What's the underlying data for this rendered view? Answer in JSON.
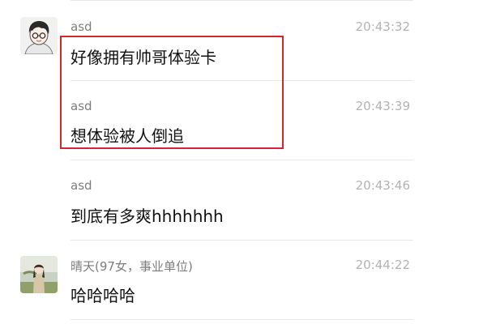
{
  "messages": [
    {
      "sender": "asd",
      "time": "20:43:32",
      "text": "好像拥有帅哥体验卡",
      "avatar": "boy-glasses-cartoon"
    },
    {
      "sender": "asd",
      "time": "20:43:39",
      "text": "想体验被人倒追"
    },
    {
      "sender": "asd",
      "time": "20:43:46",
      "text": "到底有多爽hhhhhhh"
    },
    {
      "sender": "晴天(97女，事业单位)",
      "time": "20:44:22",
      "text": "哈哈哈哈",
      "avatar": "girl-outdoor-photo"
    }
  ],
  "highlight_color": "#d4262d"
}
